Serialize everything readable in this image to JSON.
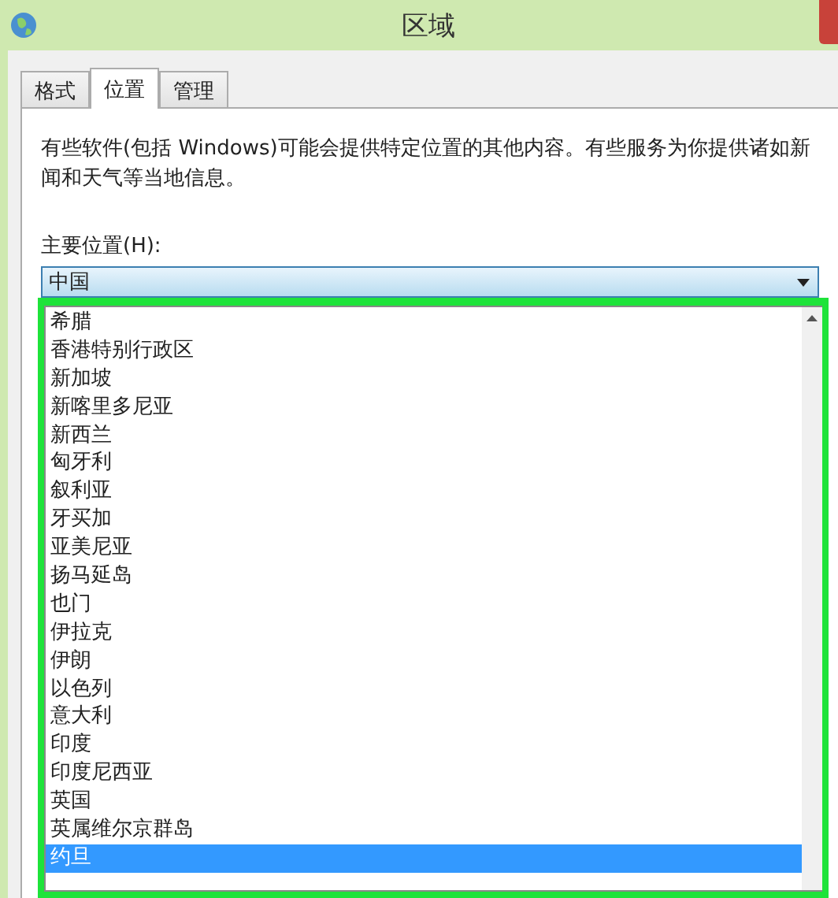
{
  "window": {
    "title": "区域"
  },
  "tabs": [
    {
      "label": "格式",
      "selected": false
    },
    {
      "label": "位置",
      "selected": true
    },
    {
      "label": "管理",
      "selected": false
    }
  ],
  "description": "有些软件(包括 Windows)可能会提供特定位置的其他内容。有些服务为你提供诸如新闻和天气等当地信息。",
  "home_location": {
    "label": "主要位置(H):",
    "value": "中国",
    "expanded": true
  },
  "dropdown_items": [
    {
      "label": "希腊",
      "selected": false
    },
    {
      "label": "香港特别行政区",
      "selected": false
    },
    {
      "label": "新加坡",
      "selected": false
    },
    {
      "label": "新喀里多尼亚",
      "selected": false
    },
    {
      "label": "新西兰",
      "selected": false
    },
    {
      "label": "匈牙利",
      "selected": false
    },
    {
      "label": "叙利亚",
      "selected": false
    },
    {
      "label": "牙买加",
      "selected": false
    },
    {
      "label": "亚美尼亚",
      "selected": false
    },
    {
      "label": "扬马延岛",
      "selected": false
    },
    {
      "label": "也门",
      "selected": false
    },
    {
      "label": "伊拉克",
      "selected": false
    },
    {
      "label": "伊朗",
      "selected": false
    },
    {
      "label": "以色列",
      "selected": false
    },
    {
      "label": "意大利",
      "selected": false
    },
    {
      "label": "印度",
      "selected": false
    },
    {
      "label": "印度尼西亚",
      "selected": false
    },
    {
      "label": "英国",
      "selected": false
    },
    {
      "label": "英属维尔京群岛",
      "selected": false
    },
    {
      "label": "约旦",
      "selected": true
    }
  ]
}
